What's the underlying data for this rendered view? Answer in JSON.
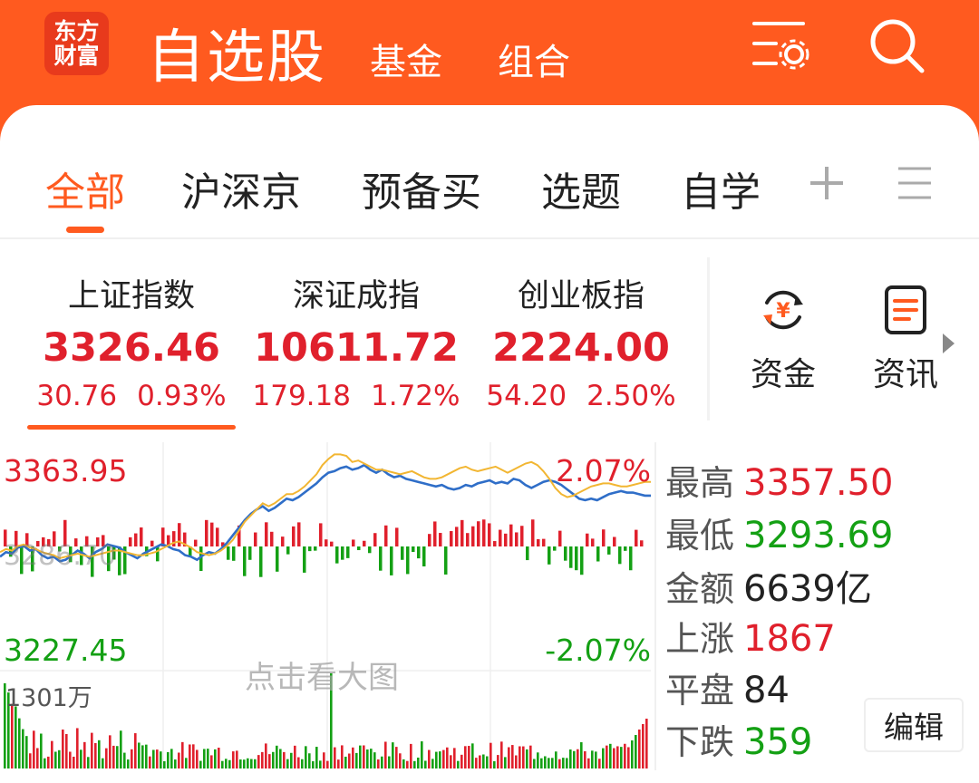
{
  "header": {
    "logo_line1": "东方",
    "logo_line2": "财富",
    "title": "自选股",
    "tabs": [
      "基金",
      "组合"
    ],
    "icons": [
      "settings-list-icon",
      "search-icon"
    ]
  },
  "category_tabs": [
    {
      "label": "全部",
      "active": true
    },
    {
      "label": "沪深京",
      "active": false
    },
    {
      "label": "预备买",
      "active": false
    },
    {
      "label": "选题",
      "active": false
    },
    {
      "label": "自学",
      "active": false
    }
  ],
  "category_icons": [
    "plus-icon",
    "menu-icon"
  ],
  "indices": [
    {
      "name": "上证指数",
      "value": "3326.46",
      "change": "30.76",
      "pct": "0.93%",
      "selected": true
    },
    {
      "name": "深证成指",
      "value": "10611.72",
      "change": "179.18",
      "pct": "1.72%",
      "selected": false
    },
    {
      "name": "创业板指",
      "value": "2224.00",
      "change": "54.20",
      "pct": "2.50%",
      "selected": false
    }
  ],
  "quick_links": [
    {
      "label": "资金",
      "icon": "yuan-cycle-icon"
    },
    {
      "label": "资讯",
      "icon": "news-doc-icon"
    }
  ],
  "chart": {
    "top_price": "3363.95",
    "top_pct": "2.07%",
    "bottom_price": "3227.45",
    "bottom_pct": "-2.07%",
    "overlay_text": "3286.70",
    "watermark": "点击看大图",
    "volume_label": "1301万",
    "colors": {
      "price_line": "#2f6ec8",
      "avg_line": "#f2b632",
      "up": "#e0202c",
      "down": "#14a014"
    }
  },
  "chart_data": {
    "type": "line",
    "ylim": [
      3227.45,
      3363.95
    ],
    "baseline": 3295.7,
    "series": [
      {
        "values": [
          3289,
          3292,
          3291,
          3295,
          3296,
          3293,
          3294,
          3290,
          3288,
          3289,
          3286,
          3287,
          3290,
          3293,
          3291,
          3288,
          3292,
          3294,
          3297,
          3296,
          3295,
          3292,
          3290,
          3288,
          3291,
          3293,
          3295,
          3297,
          3296,
          3294,
          3293,
          3290,
          3289,
          3287,
          3290,
          3292,
          3291,
          3294,
          3298,
          3303,
          3308,
          3313,
          3317,
          3320,
          3322,
          3319,
          3321,
          3324,
          3327,
          3326,
          3328,
          3331,
          3334,
          3337,
          3341,
          3344,
          3345,
          3347,
          3348,
          3346,
          3347,
          3349,
          3346,
          3344,
          3346,
          3343,
          3341,
          3342,
          3340,
          3339,
          3338,
          3337,
          3336,
          3335,
          3336,
          3334,
          3333,
          3334,
          3336,
          3335,
          3337,
          3338,
          3339,
          3337,
          3338,
          3337,
          3340,
          3339,
          3336,
          3334,
          3336,
          3338,
          3339,
          3338,
          3336,
          3333,
          3330,
          3327,
          3326,
          3327,
          3326,
          3328,
          3330,
          3331,
          3332,
          3331,
          3331,
          3330,
          3329,
          3329
        ]
      },
      {
        "values": [
          3292,
          3294,
          3293,
          3296,
          3297,
          3295,
          3294,
          3292,
          3291,
          3290,
          3288,
          3289,
          3290,
          3291,
          3290,
          3289,
          3290,
          3291,
          3292,
          3293,
          3293,
          3292,
          3291,
          3290,
          3290,
          3291,
          3292,
          3294,
          3296,
          3298,
          3299,
          3297,
          3295,
          3292,
          3291,
          3290,
          3291,
          3293,
          3296,
          3300,
          3306,
          3312,
          3316,
          3320,
          3324,
          3322,
          3324,
          3327,
          3330,
          3330,
          3332,
          3335,
          3339,
          3343,
          3349,
          3353,
          3356,
          3356,
          3355,
          3351,
          3352,
          3350,
          3348,
          3346,
          3346,
          3345,
          3344,
          3343,
          3344,
          3345,
          3343,
          3341,
          3340,
          3340,
          3341,
          3343,
          3345,
          3347,
          3348,
          3346,
          3345,
          3346,
          3347,
          3348,
          3346,
          3344,
          3346,
          3348,
          3350,
          3351,
          3349,
          3345,
          3340,
          3334,
          3330,
          3328,
          3329,
          3331,
          3333,
          3335,
          3336,
          3337,
          3337,
          3336,
          3335,
          3335,
          3336,
          3337,
          3338,
          3338
        ]
      }
    ]
  },
  "stats": [
    {
      "label": "最高",
      "value": "3357.50",
      "color": "red"
    },
    {
      "label": "最低",
      "value": "3293.69",
      "color": "green"
    },
    {
      "label": "金额",
      "value": "6639亿",
      "color": "dark"
    },
    {
      "label": "上涨",
      "value": "1867",
      "color": "red"
    },
    {
      "label": "平盘",
      "value": "84",
      "color": "dark"
    },
    {
      "label": "下跌",
      "value": "359",
      "color": "green"
    }
  ],
  "edit_button": "编辑"
}
